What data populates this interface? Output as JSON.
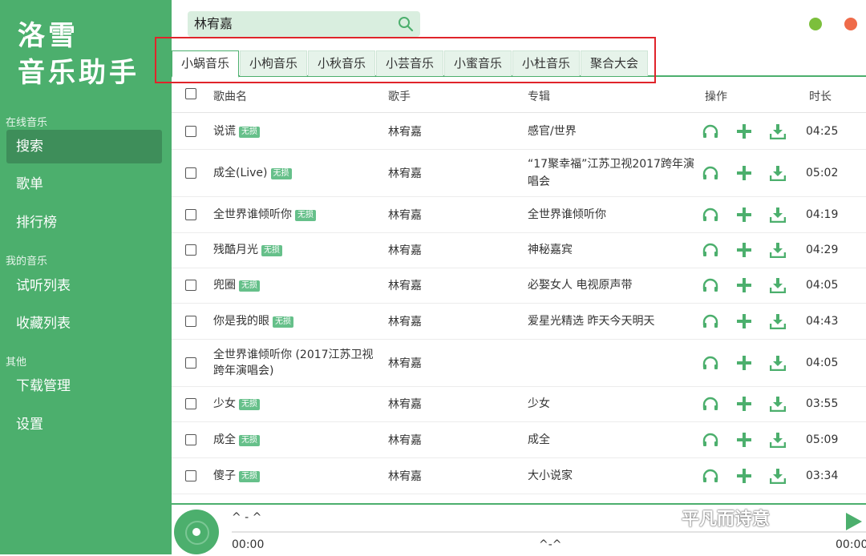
{
  "app": {
    "logo_line1": "洛雪",
    "logo_line2": "音乐助手"
  },
  "colors": {
    "primary": "#4caf6d",
    "dark": "#3e8e5a",
    "min": "#7cbf3c",
    "close": "#ef6b4a",
    "highlight": "#e0242b"
  },
  "sidebar": {
    "sections": [
      {
        "title": "在线音乐",
        "items": [
          "搜索",
          "歌单",
          "排行榜"
        ]
      },
      {
        "title": "我的音乐",
        "items": [
          "试听列表",
          "收藏列表"
        ]
      },
      {
        "title": "其他",
        "items": [
          "下载管理",
          "设置"
        ]
      }
    ],
    "active": "搜索"
  },
  "search": {
    "value": "林宥嘉",
    "icon": "search-icon"
  },
  "tabs": [
    "小蜗音乐",
    "小枸音乐",
    "小秋音乐",
    "小芸音乐",
    "小蜜音乐",
    "小杜音乐",
    "聚合大会"
  ],
  "active_tab": "小蜗音乐",
  "table": {
    "headers": {
      "name": "歌曲名",
      "artist": "歌手",
      "album": "专辑",
      "ops": "操作",
      "duration": "时长"
    },
    "rows": [
      {
        "name": "说谎",
        "badge": "无损",
        "artist": "林宥嘉",
        "album": "感官/世界",
        "duration": "04:25"
      },
      {
        "name": "成全(Live)",
        "badge": "无损",
        "artist": "林宥嘉",
        "album": "“17聚幸福”江苏卫视2017跨年演唱会",
        "duration": "05:02"
      },
      {
        "name": "全世界谁倾听你",
        "badge": "无损",
        "artist": "林宥嘉",
        "album": "全世界谁倾听你",
        "duration": "04:19"
      },
      {
        "name": "残酷月光",
        "badge": "无损",
        "artist": "林宥嘉",
        "album": "神秘嘉宾",
        "duration": "04:29"
      },
      {
        "name": "兜圈",
        "badge": "无损",
        "artist": "林宥嘉",
        "album": "必娶女人 电视原声带",
        "duration": "04:05"
      },
      {
        "name": "你是我的眼",
        "badge": "无损",
        "artist": "林宥嘉",
        "album": "爱星光精选 昨天今天明天",
        "duration": "04:43"
      },
      {
        "name": "全世界谁倾听你 (2017江苏卫视跨年演唱会)",
        "badge": "",
        "artist": "林宥嘉",
        "album": "",
        "duration": "04:05"
      },
      {
        "name": "少女",
        "badge": "无损",
        "artist": "林宥嘉",
        "album": "少女",
        "duration": "03:55"
      },
      {
        "name": "成全",
        "badge": "无损",
        "artist": "林宥嘉",
        "album": "成全",
        "duration": "05:09"
      },
      {
        "name": "傻子",
        "badge": "无损",
        "artist": "林宥嘉",
        "album": "大小说家",
        "duration": "03:34"
      }
    ]
  },
  "player": {
    "title": "^ - ^",
    "current": "00:00",
    "center": "^-^",
    "total": "00:00"
  },
  "watermark": "平凡而诗意"
}
